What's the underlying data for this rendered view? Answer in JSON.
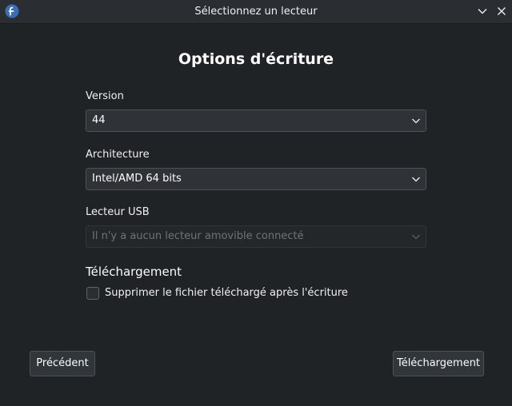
{
  "window": {
    "title": "Sélectionnez un lecteur",
    "app_icon": "fedora-logo-icon",
    "buttons": [
      "chevron-down-icon",
      "close-icon"
    ]
  },
  "heading": "Options d'écriture",
  "version": {
    "label": "Version",
    "value": "44"
  },
  "architecture": {
    "label": "Architecture",
    "value": "Intel/AMD 64 bits"
  },
  "usb_drive": {
    "label": "Lecteur USB",
    "value": "Il n'y a aucun lecteur amovible connecté",
    "disabled": true
  },
  "download": {
    "section_title": "Téléchargement",
    "delete_after_write_label": "Supprimer le fichier téléchargé après l'écriture",
    "delete_after_write_checked": false
  },
  "footer": {
    "previous_label": "Précédent",
    "download_label": "Téléchargement"
  },
  "colors": {
    "background": "#202326",
    "titlebar": "#2a2e32",
    "accent_logo": "#3c6eb4"
  }
}
